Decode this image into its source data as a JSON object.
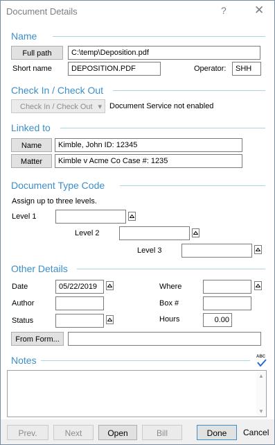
{
  "window": {
    "title": "Document Details",
    "help_label": "?",
    "close_label": "✕"
  },
  "name_section": {
    "header": "Name",
    "full_path_button": "Full path",
    "full_path_value": "C:\\temp\\Deposition.pdf",
    "short_name_label": "Short name",
    "short_name_value": "DEPOSITION.PDF",
    "operator_label": "Operator:",
    "operator_value": "SHH"
  },
  "checkin_section": {
    "header": "Check In / Check Out",
    "button_label": "Check In / Check Out",
    "status_text": "Document Service not enabled"
  },
  "linked_section": {
    "header": "Linked to",
    "name_button": "Name",
    "name_value": "Kimble, John  ID: 12345",
    "matter_button": "Matter",
    "matter_value": "Kimble v Acme Co  Case #: 1235"
  },
  "doc_type_section": {
    "header": "Document Type Code",
    "hint": "Assign up to three levels.",
    "level1_label": "Level 1",
    "level2_label": "Level 2",
    "level3_label": "Level 3"
  },
  "other_section": {
    "header": "Other Details",
    "date_label": "Date",
    "date_value": "05/22/2019",
    "where_label": "Where",
    "author_label": "Author",
    "box_label": "Box #",
    "status_label": "Status",
    "hours_label": "Hours",
    "hours_value": "0.00",
    "from_form_button": "From Form..."
  },
  "notes_section": {
    "header": "Notes",
    "spellcheck_icon_text": "ABC"
  },
  "footer": {
    "prev_label": "Prev.",
    "next_label": "Next",
    "open_label": "Open",
    "bill_label": "Bill",
    "done_label": "Done",
    "cancel_label": "Cancel"
  },
  "colors": {
    "section_header": "#3c8ec8",
    "rule": "#a7d5e6",
    "accent_check": "#2b6ad6"
  }
}
